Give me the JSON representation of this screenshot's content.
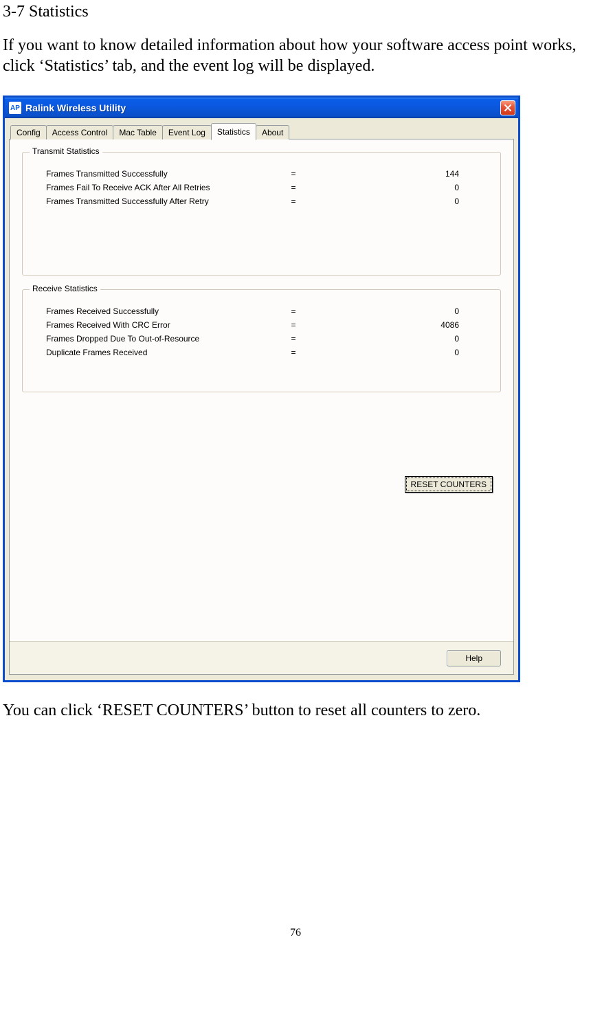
{
  "doc": {
    "section_heading": "3-7 Statistics",
    "intro": "If you want to know detailed information about how your software access point works, click ‘Statistics’ tab, and the event log will be displayed.",
    "outro": "You can click ‘RESET COUNTERS’ button to reset all counters to zero.",
    "page_number": "76"
  },
  "dialog": {
    "title": "Ralink Wireless Utility",
    "app_icon_text": "AP",
    "tabs": [
      "Config",
      "Access Control",
      "Mac Table",
      "Event Log",
      "Statistics",
      "About"
    ],
    "active_tab_index": 4,
    "groups": {
      "transmit": {
        "legend": "Transmit Statistics",
        "rows": [
          {
            "label": "Frames Transmitted Successfully",
            "value": "144"
          },
          {
            "label": "Frames Fail To Receive ACK After All Retries",
            "value": "0"
          },
          {
            "label": "Frames Transmitted Successfully After Retry",
            "value": "0"
          }
        ]
      },
      "receive": {
        "legend": "Receive Statistics",
        "rows": [
          {
            "label": "Frames Received Successfully",
            "value": "0"
          },
          {
            "label": "Frames Received With CRC Error",
            "value": "4086"
          },
          {
            "label": "Frames Dropped Due To Out-of-Resource",
            "value": "0"
          },
          {
            "label": "Duplicate Frames Received",
            "value": "0"
          }
        ]
      }
    },
    "buttons": {
      "reset": "RESET COUNTERS",
      "help": "Help"
    },
    "eq": "="
  }
}
